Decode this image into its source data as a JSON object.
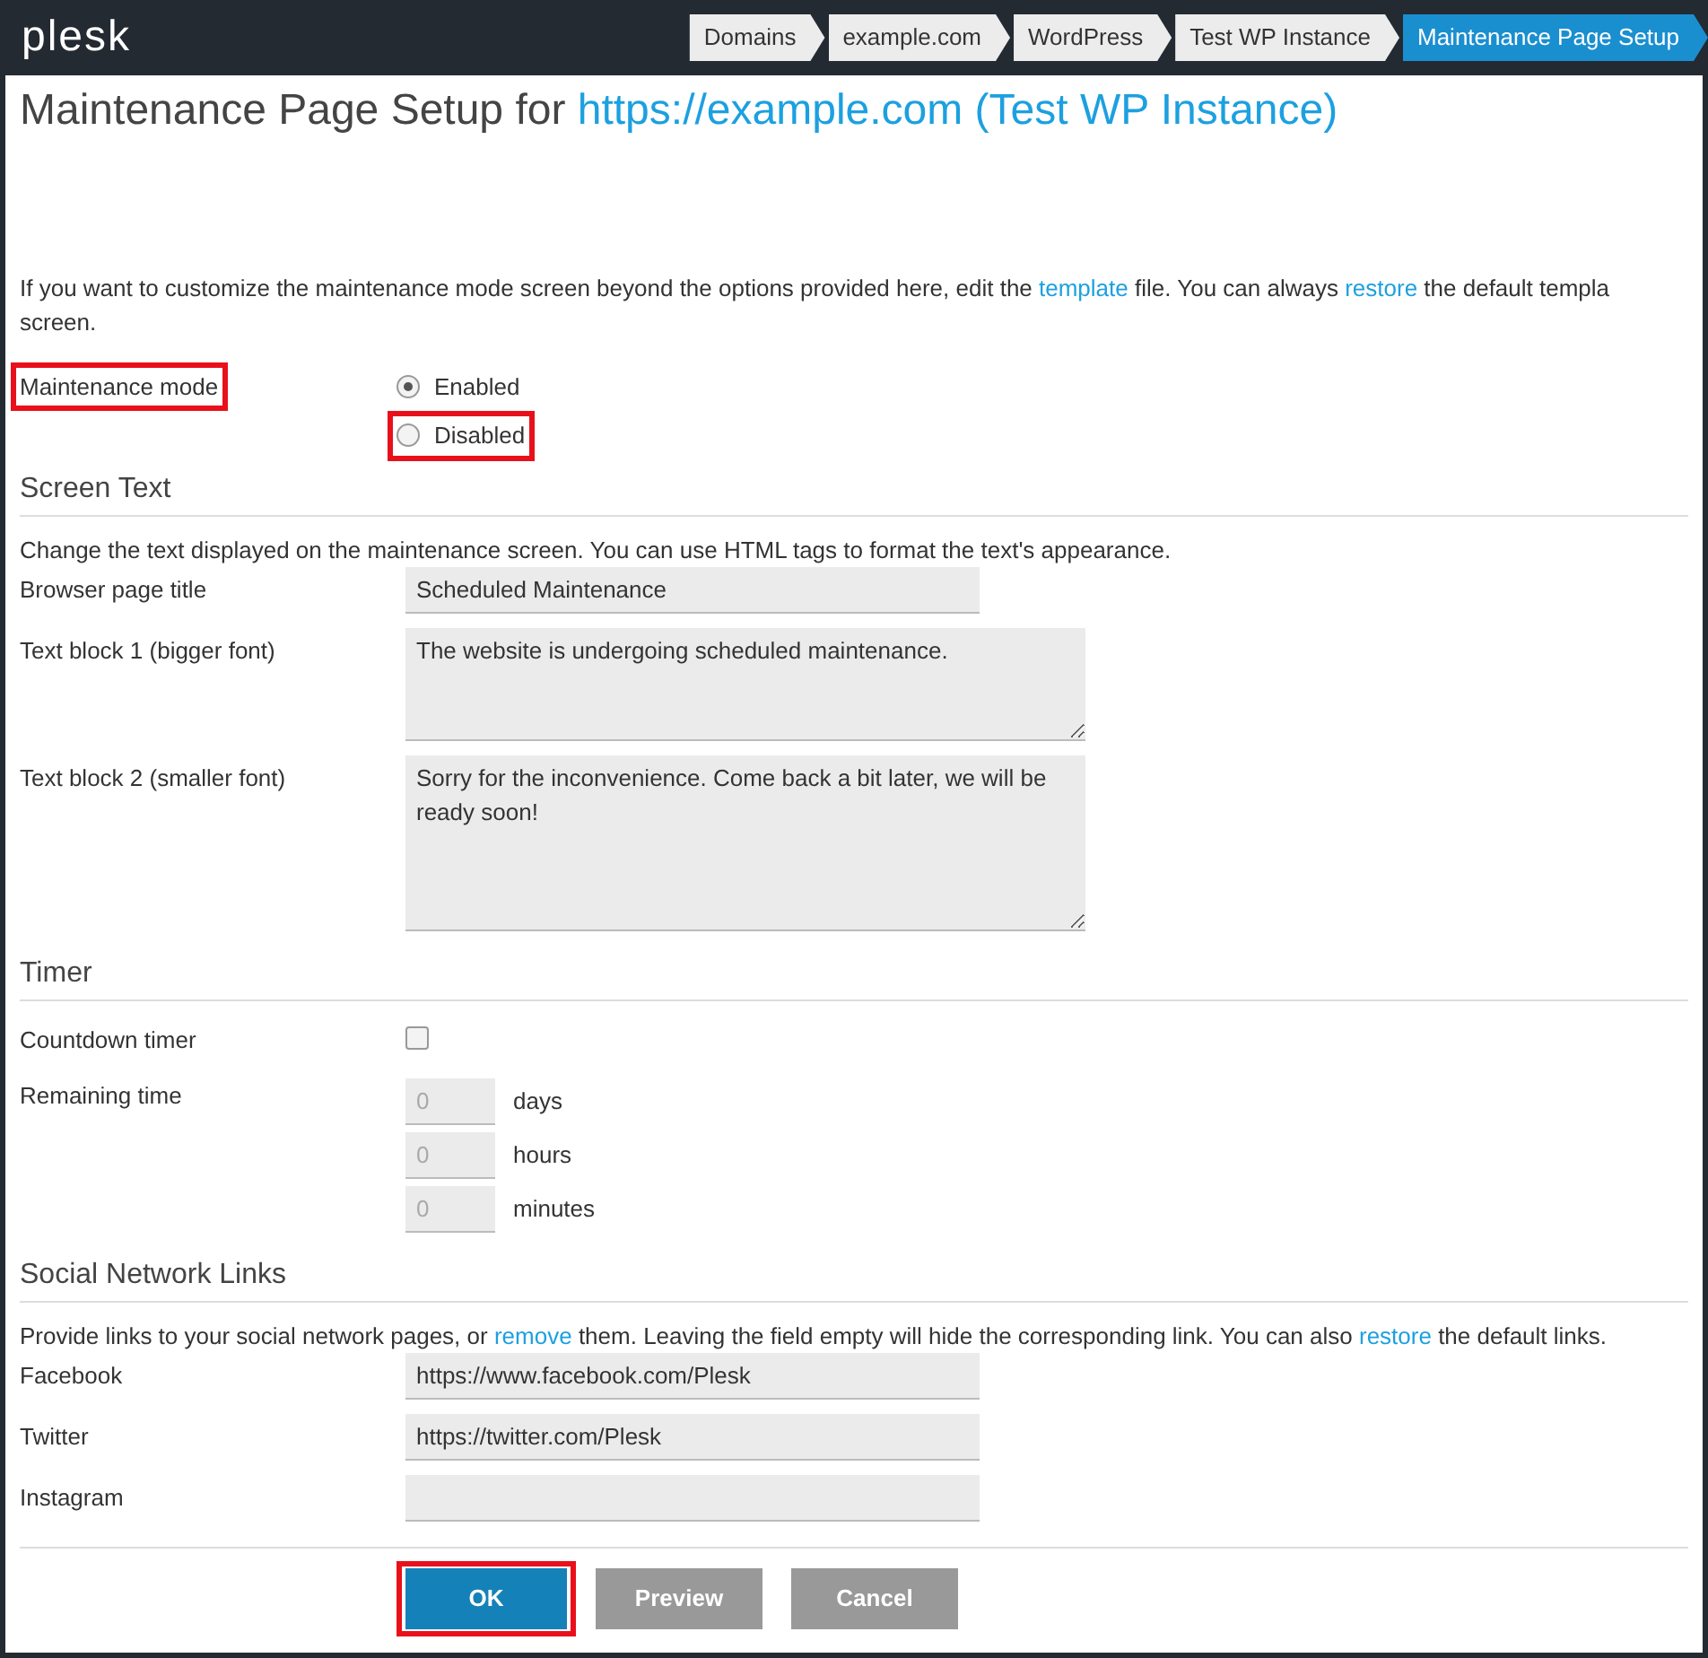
{
  "header": {
    "logo": "plesk"
  },
  "breadcrumbs": [
    {
      "label": "Domains",
      "selected": false
    },
    {
      "label": "example.com",
      "selected": false
    },
    {
      "label": "WordPress",
      "selected": false
    },
    {
      "label": "Test WP Instance",
      "selected": false
    },
    {
      "label": "Maintenance Page Setup",
      "selected": true
    }
  ],
  "title": {
    "text": "Maintenance Page Setup for ",
    "link": "https://example.com (Test WP Instance)"
  },
  "intro": {
    "segments": [
      {
        "kind": "text",
        "text": "If you want to customize the maintenance mode screen beyond the options provided here, edit the "
      },
      {
        "kind": "link",
        "text": "template"
      },
      {
        "kind": "text",
        "text": " file. You can always "
      },
      {
        "kind": "link",
        "text": "restore"
      },
      {
        "kind": "text",
        "text": " the default templa"
      }
    ],
    "continuation": "screen."
  },
  "maintenance_mode": {
    "label": "Maintenance mode",
    "highlighted": true,
    "options": [
      {
        "label": "Enabled",
        "selected": true,
        "highlighted": false
      },
      {
        "label": "Disabled",
        "selected": false,
        "highlighted": true
      }
    ]
  },
  "sections": [
    {
      "title": "Screen Text",
      "description": [
        {
          "kind": "text",
          "text": "Change the text displayed on the maintenance screen. You can use HTML tags to format the text's appearance."
        }
      ],
      "fields": [
        {
          "kind": "input",
          "label": "Browser page title",
          "value": "Scheduled Maintenance"
        },
        {
          "kind": "textarea_short",
          "label": "Text block 1 (bigger font)",
          "value": "The website is undergoing scheduled maintenance."
        },
        {
          "kind": "textarea_tall",
          "label": "Text block 2 (smaller font)",
          "value": "Sorry for the inconvenience. Come back a bit later, we will be ready soon!"
        }
      ]
    },
    {
      "title": "Timer",
      "fields": [
        {
          "kind": "checkbox",
          "label": "Countdown timer",
          "checked": false
        },
        {
          "kind": "duration",
          "label": "Remaining time",
          "units": [
            {
              "placeholder": "0",
              "unit": "days"
            },
            {
              "placeholder": "0",
              "unit": "hours"
            },
            {
              "placeholder": "0",
              "unit": "minutes"
            }
          ]
        }
      ]
    },
    {
      "title": "Social Network Links",
      "description": [
        {
          "kind": "text",
          "text": "Provide links to your social network pages, or "
        },
        {
          "kind": "link",
          "text": "remove"
        },
        {
          "kind": "text",
          "text": " them. Leaving the field empty will hide the corresponding link. You can also "
        },
        {
          "kind": "link",
          "text": "restore"
        },
        {
          "kind": "text",
          "text": " the default links."
        }
      ],
      "fields": [
        {
          "kind": "input",
          "label": "Facebook",
          "value": "https://www.facebook.com/Plesk"
        },
        {
          "kind": "input",
          "label": "Twitter",
          "value": "https://twitter.com/Plesk"
        },
        {
          "kind": "input",
          "label": "Instagram"
        }
      ]
    }
  ],
  "buttons": [
    {
      "label": "OK",
      "kind": "primary",
      "highlighted": true
    },
    {
      "label": "Preview",
      "kind": "secondary",
      "highlighted": false
    },
    {
      "label": "Cancel",
      "kind": "secondary",
      "highlighted": false
    }
  ]
}
